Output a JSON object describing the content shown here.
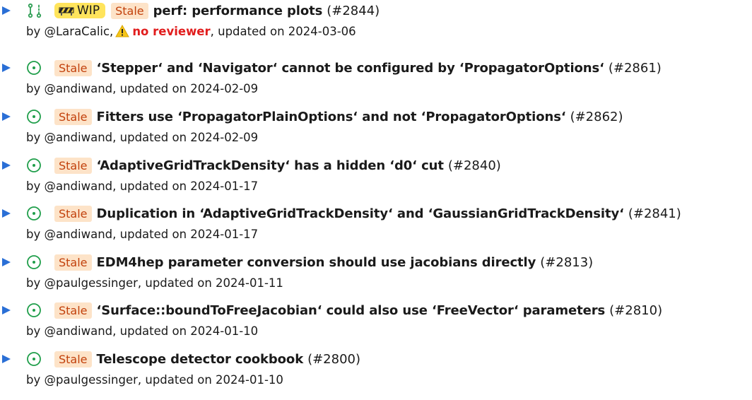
{
  "items": [
    {
      "icon": "draft-pr-icon",
      "wip_label": "WIP",
      "stale_label": "Stale",
      "title": "perf: performance plots",
      "number": "(#2844)",
      "by": "by @LaraCalic,",
      "no_reviewer": "no reviewer",
      "updated": ", updated on 2024-03-06"
    },
    {
      "icon": "open-issue-icon",
      "stale_label": "Stale",
      "title": "‘Stepper‘ and ‘Navigator‘ cannot be configured by ‘PropagatorOptions‘",
      "number": "(#2861)",
      "meta": "by @andiwand, updated on 2024-02-09"
    },
    {
      "icon": "open-issue-icon",
      "stale_label": "Stale",
      "title": "Fitters use ‘PropagatorPlainOptions‘ and not ‘PropagatorOptions‘",
      "number": "(#2862)",
      "meta": "by @andiwand, updated on 2024-02-09"
    },
    {
      "icon": "open-issue-icon",
      "stale_label": "Stale",
      "title": "‘AdaptiveGridTrackDensity‘ has a hidden ‘d0‘ cut",
      "number": "(#2840)",
      "meta": "by @andiwand, updated on 2024-01-17"
    },
    {
      "icon": "open-issue-icon",
      "stale_label": "Stale",
      "title": "Duplication in ‘AdaptiveGridTrackDensity‘ and ‘GaussianGridTrackDensity‘",
      "number": "(#2841)",
      "meta": "by @andiwand, updated on 2024-01-17"
    },
    {
      "icon": "open-issue-icon",
      "stale_label": "Stale",
      "title": "EDM4hep parameter conversion should use jacobians directly",
      "number": "(#2813)",
      "meta": "by @paulgessinger, updated on 2024-01-11"
    },
    {
      "icon": "open-issue-icon",
      "stale_label": "Stale",
      "title": "‘Surface::boundToFreeJacobian‘ could also use ‘FreeVector‘ parameters",
      "number": "(#2810)",
      "meta": "by @andiwand, updated on 2024-01-10"
    },
    {
      "icon": "open-issue-icon",
      "stale_label": "Stale",
      "title": "Telescope detector cookbook",
      "number": "(#2800)",
      "meta": "by @paulgessinger, updated on 2024-01-10"
    }
  ],
  "colors": {
    "arrow": "#2a6fd6",
    "open_issue": "#1f9e4a",
    "draft_pr": "#2f9e55",
    "stale_bg": "#fde3c8",
    "stale_text": "#c2410c",
    "wip_bg": "#ffe45c",
    "no_reviewer": "#e11d1d"
  }
}
